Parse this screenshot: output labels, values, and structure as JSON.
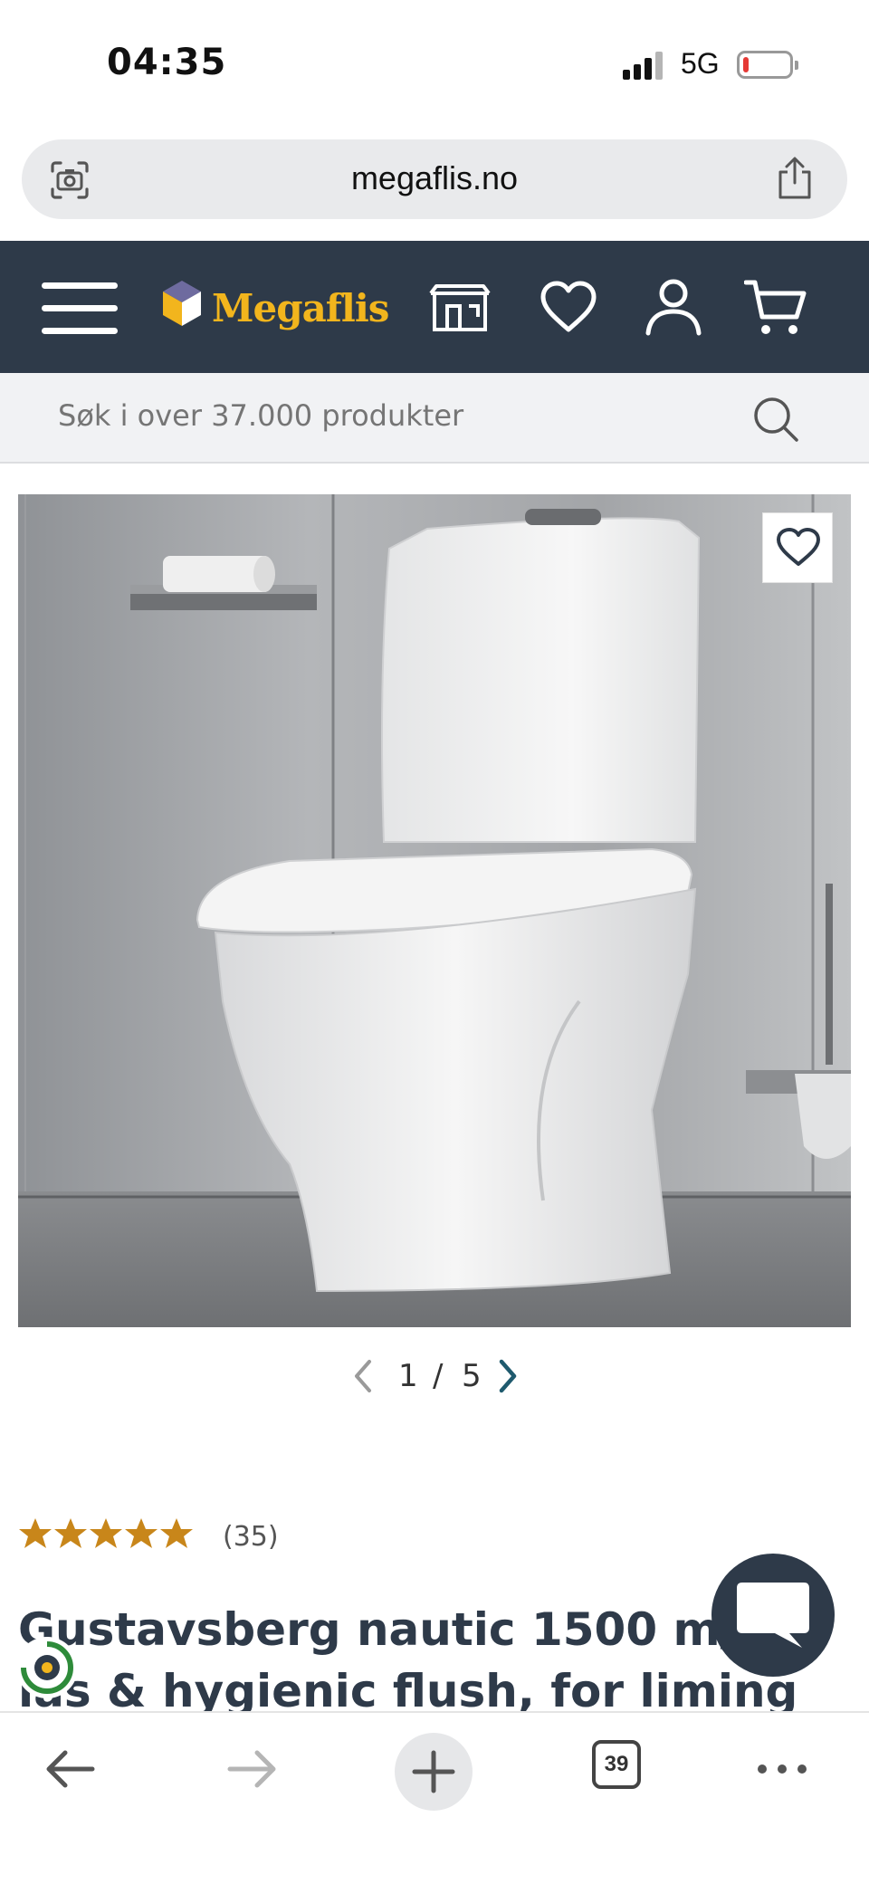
{
  "status_bar": {
    "time": "04:35",
    "network": "5G",
    "battery_level": 0.1
  },
  "browser": {
    "url": "megaflis.no",
    "tabs_count": "39"
  },
  "site": {
    "logo_text": "Megaflis",
    "brand_color": "#f2b51d",
    "header_color": "#2e3a49"
  },
  "search": {
    "placeholder": "Søk i over 37.000 produkter"
  },
  "gallery": {
    "current": "1",
    "separator": "/",
    "total": "5"
  },
  "product": {
    "rating": 5,
    "review_count": "(35)",
    "title": "Gustavsberg nautic 1500 m/s-lås & hygienic flush, for liming"
  },
  "icons": {
    "header": [
      "menu-icon",
      "store-icon",
      "heart-icon",
      "user-icon",
      "cart-icon"
    ],
    "bottom": [
      "back-arrow-icon",
      "forward-arrow-icon",
      "plus-icon",
      "tabs-icon",
      "more-icon"
    ]
  }
}
